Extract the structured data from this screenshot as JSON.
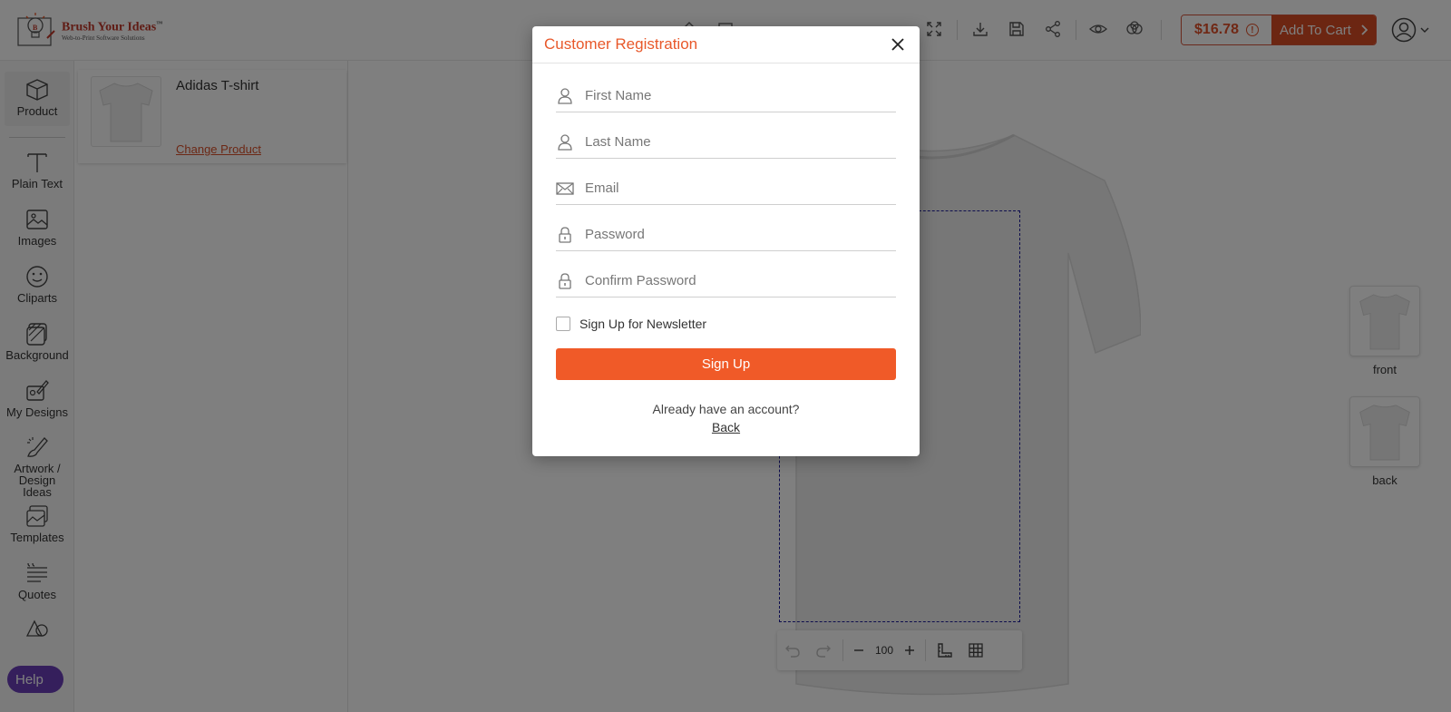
{
  "brand": {
    "name": "Brush Your Ideas",
    "tm": "™",
    "tagline": "Web-to-Print Software Solutions"
  },
  "header": {
    "price": "$16.78",
    "price_info_glyph": "!",
    "add_to_cart": "Add To Cart"
  },
  "sidebar": {
    "items": [
      {
        "label": "Product",
        "icon": "box-icon"
      },
      {
        "label": "Plain Text",
        "icon": "text-icon"
      },
      {
        "label": "Images",
        "icon": "image-icon"
      },
      {
        "label": "Cliparts",
        "icon": "smiley-icon"
      },
      {
        "label": "Background",
        "icon": "background-icon"
      },
      {
        "label": "My Designs",
        "icon": "my-designs-icon"
      },
      {
        "label": "Artwork /\nDesign Ideas",
        "icon": "artwork-icon"
      },
      {
        "label": "Templates",
        "icon": "templates-icon"
      },
      {
        "label": "Quotes",
        "icon": "quotes-icon"
      }
    ],
    "help": "Help"
  },
  "panel": {
    "product_name": "Adidas T-shirt",
    "change_product": "Change Product"
  },
  "canvas": {
    "zoom": "100",
    "views": [
      {
        "label": "front"
      },
      {
        "label": "back"
      }
    ]
  },
  "modal": {
    "title": "Customer Registration",
    "fields": [
      {
        "placeholder": "First Name",
        "icon": "user-icon"
      },
      {
        "placeholder": "Last Name",
        "icon": "user-icon"
      },
      {
        "placeholder": "Email",
        "icon": "envelope-icon"
      },
      {
        "placeholder": "Password",
        "icon": "lock-icon"
      },
      {
        "placeholder": "Confirm Password",
        "icon": "lock-icon"
      }
    ],
    "newsletter_label": "Sign Up for Newsletter",
    "signup_button": "Sign Up",
    "already_text": "Already have an account?",
    "back_link": "Back"
  },
  "colors": {
    "accent": "#f05a28",
    "title": "#e8582a",
    "help": "#6b3fb8"
  }
}
